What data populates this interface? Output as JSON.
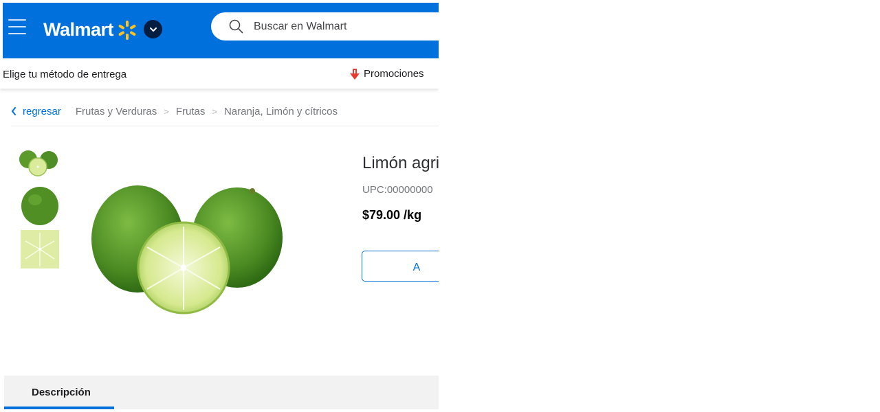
{
  "header": {
    "brand": "Walmart",
    "search_placeholder": "Buscar en Walmart",
    "colors": {
      "header_bg": "#0071dc",
      "spark": "#ffc220",
      "chevron_bg": "#041e42"
    },
    "icons": [
      "menu-icon",
      "spark-icon",
      "chevron-down-icon",
      "search-icon"
    ]
  },
  "delivery_bar": {
    "delivery_label": "Elige tu método de entrega",
    "promotions_label": "Promociones",
    "promo_icon_color": "#e63b2e"
  },
  "breadcrumb": {
    "back_label": "regresar",
    "items": [
      "Frutas y Verduras",
      "Frutas",
      "Naranja, Limón y cítricos"
    ]
  },
  "product": {
    "title": "Limón agri",
    "upc": "UPC:00000000",
    "price": "$79.00 /kg",
    "add_button_label": "A"
  },
  "tabs": {
    "description_label": "Descripción",
    "accent": "#0071dc"
  }
}
